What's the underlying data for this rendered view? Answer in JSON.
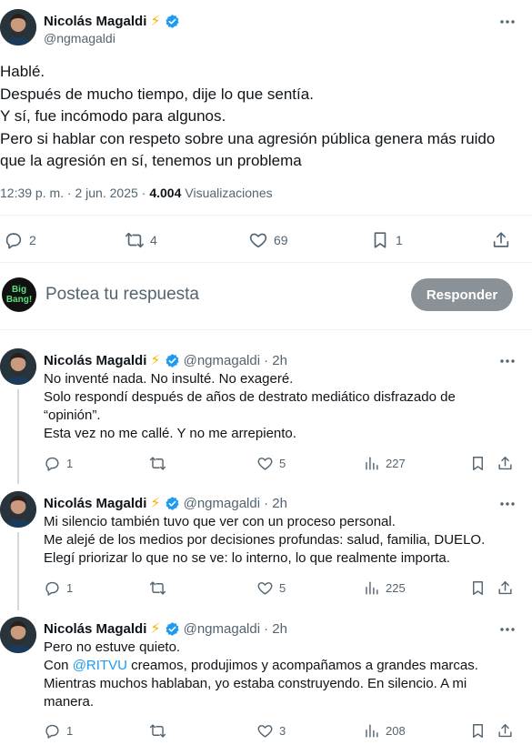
{
  "main_tweet": {
    "author_name": "Nicolás Magaldi",
    "handle": "@ngmagaldi",
    "lines": [
      "Hablé.",
      "Después de mucho tiempo, dije lo que sentía.",
      "Y sí, fue incómodo para algunos.",
      "Pero si hablar con respeto sobre una agresión pública genera más ruido",
      "que la agresión en sí, tenemos un problema"
    ],
    "timestamp": "12:39 p. m. · 2 jun. 2025 ·",
    "views_count": "4.004",
    "views_label": "Visualizaciones",
    "replies": "2",
    "retweets": "4",
    "likes": "69",
    "bookmarks": "1"
  },
  "composer": {
    "avatar_text_1": "Big",
    "avatar_text_2": "Bang!",
    "placeholder": "Postea tu respuesta",
    "reply_button": "Responder"
  },
  "replies": [
    {
      "author_name": "Nicolás Magaldi",
      "handle": "@ngmagaldi",
      "time": "· 2h",
      "lines": [
        "No inventé nada. No insulté. No exageré.",
        "Solo respondí después de años de destrato mediático disfrazado de",
        "“opinión”.",
        "Esta vez no me callé. Y no me arrepiento."
      ],
      "replies": "1",
      "likes": "5",
      "views": "227"
    },
    {
      "author_name": "Nicolás Magaldi",
      "handle": "@ngmagaldi",
      "time": "· 2h",
      "lines": [
        "Mi silencio también tuvo que ver con un proceso personal.",
        "Me alejé de los medios por decisiones profundas: salud, familia, DUELO.",
        "Elegí priorizar lo que no se ve: lo interno, lo que realmente importa."
      ],
      "replies": "1",
      "likes": "5",
      "views": "225"
    },
    {
      "author_name": "Nicolás Magaldi",
      "handle": "@ngmagaldi",
      "time": "· 2h",
      "line1": "Pero no estuve quieto.",
      "line2_prefix": "Con ",
      "line2_mention": "@RITVU",
      "line2_suffix": " creamos, produjimos y acompañamos a grandes marcas.",
      "line3": "Mientras muchos hablaban, yo estaba construyendo. En silencio. A mi",
      "line4": "manera.",
      "replies": "1",
      "likes": "3",
      "views": "208"
    }
  ],
  "colors": {
    "accent": "#1d9bf0",
    "text": "#0f1419",
    "muted": "#536471",
    "button_bg": "#8b9297"
  },
  "icons": [
    "lightning-icon",
    "verified-icon",
    "more-icon",
    "reply-icon",
    "retweet-icon",
    "like-icon",
    "bookmark-icon",
    "share-icon",
    "views-icon"
  ]
}
